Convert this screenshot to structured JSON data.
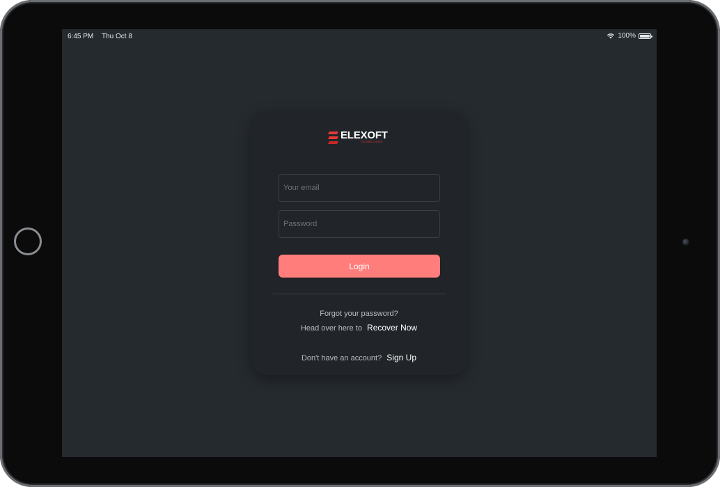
{
  "status_bar": {
    "time": "6:45 PM",
    "date": "Thu Oct 8",
    "battery": "100%",
    "battery_level": 1.0,
    "wifi_icon": "wifi-icon",
    "battery_icon": "battery-icon"
  },
  "brand": {
    "name": "ELEXOFT",
    "subtitle": "TECHNOLOGIES",
    "accent_color": "#e53935"
  },
  "form": {
    "email_placeholder": "Your email",
    "password_placeholder": "Password",
    "login_label": "Login",
    "login_color": "#ff7d7b"
  },
  "links": {
    "forgot_text": "Forgot your password?",
    "recover_prefix": "Head over here to",
    "recover_label": "Recover Now",
    "signup_prefix": "Don't have an account?",
    "signup_label": "Sign Up"
  }
}
